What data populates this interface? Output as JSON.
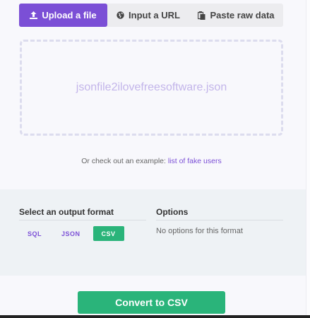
{
  "tabs": [
    {
      "label": "Upload a file",
      "icon": "upload-icon",
      "active": true
    },
    {
      "label": "Input a URL",
      "icon": "globe-icon",
      "active": false
    },
    {
      "label": "Paste raw data",
      "icon": "paste-icon",
      "active": false
    }
  ],
  "dropzone": {
    "filename": "jsonfile2ilovefreesoftware.json"
  },
  "example": {
    "prefix": "Or check out an example:",
    "link": "list of fake users"
  },
  "output": {
    "format_title": "Select an output format",
    "formats": [
      {
        "label": "SQL",
        "selected": false
      },
      {
        "label": "JSON",
        "selected": false
      },
      {
        "label": "CSV",
        "selected": true
      }
    ],
    "options_title": "Options",
    "options_text": "No options for this format"
  },
  "convert_label": "Convert to CSV",
  "colors": {
    "accent": "#7b4fd6",
    "success": "#2ab47a",
    "tab_bg": "#ececef",
    "panel_bg": "#eef2f5"
  }
}
